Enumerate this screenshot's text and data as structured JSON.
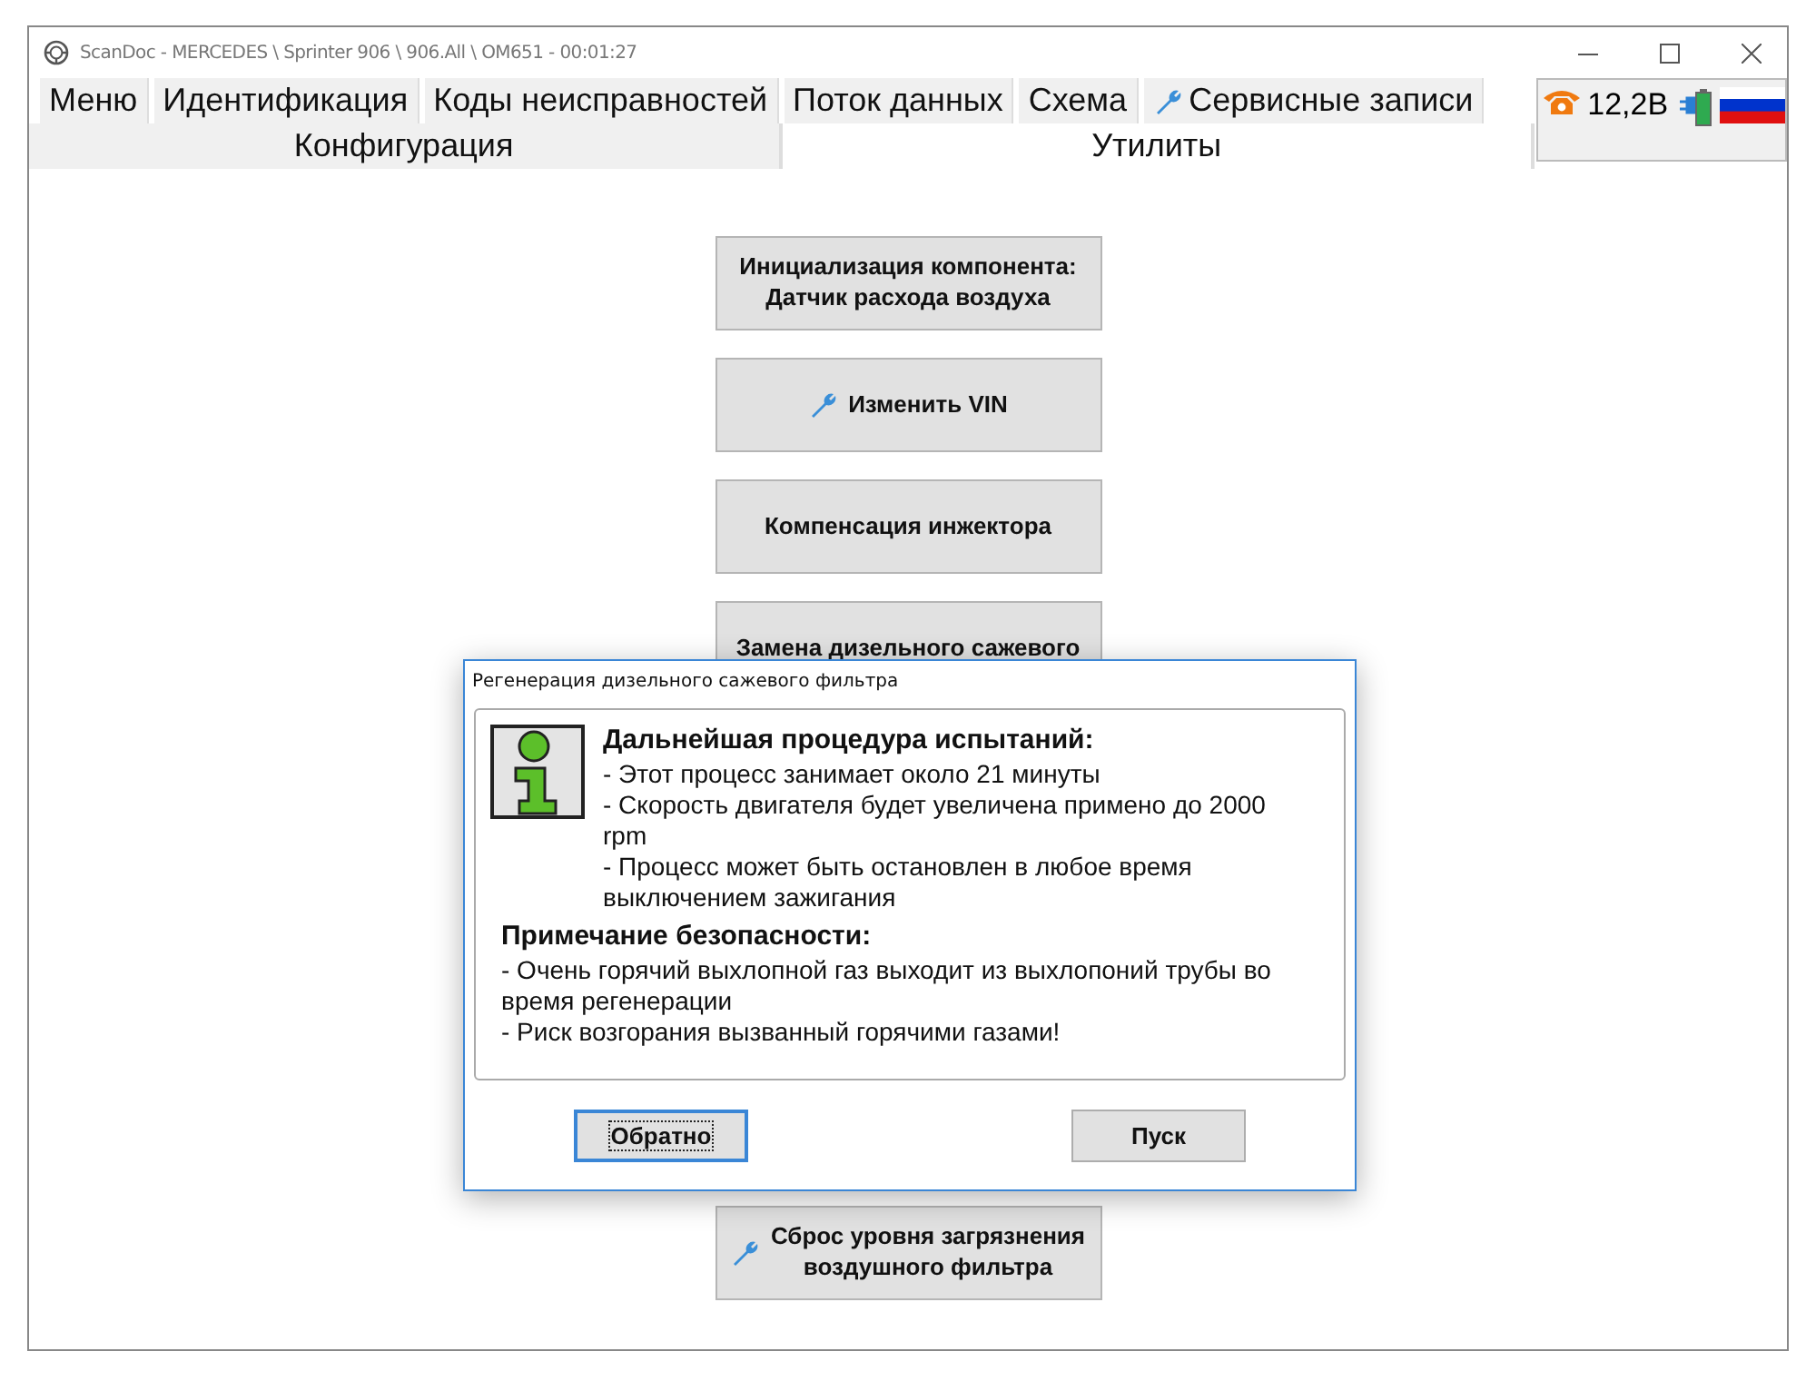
{
  "window": {
    "title": "ScanDoc - MERCEDES \\ Sprinter 906 \\ 906.All \\ OM651 - 00:01:27"
  },
  "tabs_row_1": [
    {
      "label": "Меню",
      "selected": false,
      "kind": "plain"
    },
    {
      "label": "Идентификация",
      "selected": false,
      "kind": "plain"
    },
    {
      "label": "Коды неисправностей",
      "selected": false,
      "kind": "plain"
    },
    {
      "label": "Поток данных",
      "selected": false,
      "kind": "plain"
    },
    {
      "label": "Схема",
      "selected": false,
      "kind": "plain"
    },
    {
      "label": "Сервисные записи",
      "selected": false,
      "kind": "tool"
    }
  ],
  "tabs_row_2": [
    {
      "label": "Конфигурация",
      "selected": false
    },
    {
      "label": "Утилиты",
      "selected": true
    }
  ],
  "status": {
    "voltage": "12,2В"
  },
  "buttons": [
    {
      "label": "Инициализация компонента:\nДатчик расхода воздуха",
      "kind": "plain"
    },
    {
      "label": "Изменить VIN",
      "kind": "tool"
    },
    {
      "label": "Компенсация инжектора",
      "kind": "plain"
    },
    {
      "label": "Замена дизельного сажевого",
      "kind": "plain"
    },
    {
      "kind": "gap"
    },
    {
      "label": "Сброс уровня загрязнения\nвоздушного фильтра",
      "kind": "tool"
    }
  ],
  "dialog": {
    "title": "Регенерация дизельного сажевого фильтра",
    "heading": "Дальнейшая процедура испытаний:",
    "lines": [
      "- Этот процесс занимает около 21 минуты",
      "- Скорость двигателя будет увеличена примено до 2000 rpm",
      "- Процесс может быть остановлен в любое время выключением зажигания"
    ],
    "note_heading": "Примечание безопасности:",
    "note_lines": [
      "- Очень горячий выхлопной газ выходит из выхлопоний трубы во время регенерации",
      "- Риск возгорания вызванный горячими газами!"
    ],
    "buttons": [
      {
        "label": "Обратно",
        "focused": true
      },
      {
        "label": "Пуск",
        "focused": false
      }
    ]
  }
}
